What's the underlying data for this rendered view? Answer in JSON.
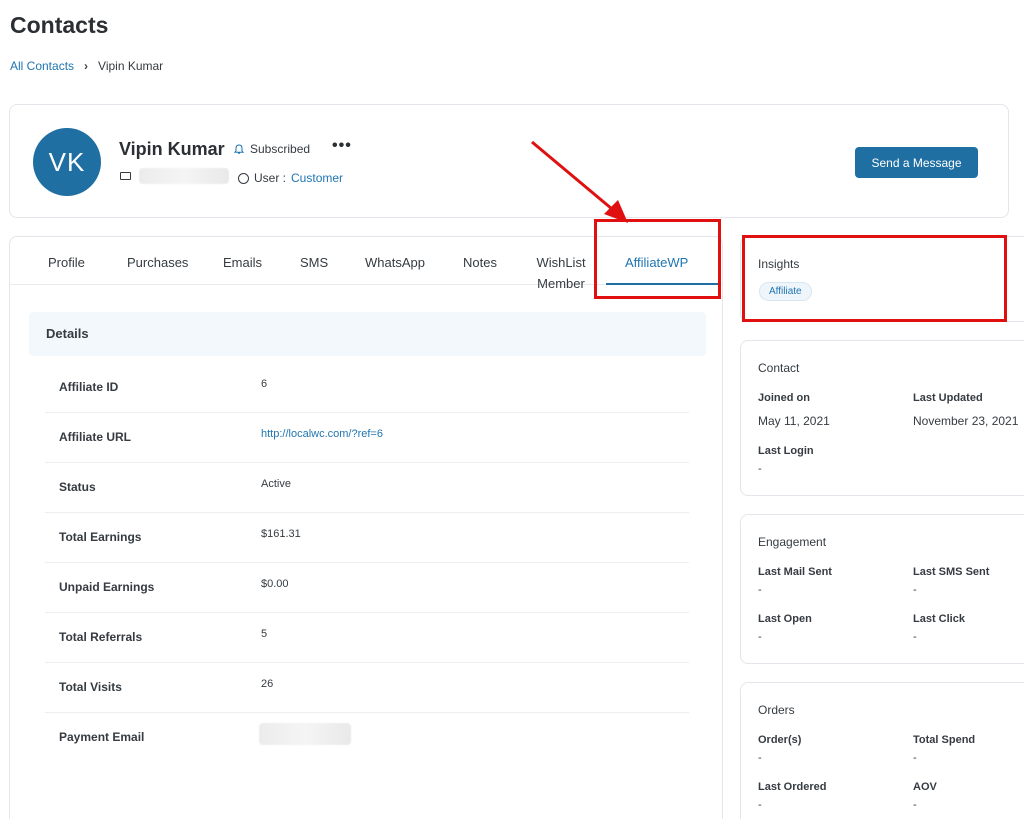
{
  "page": {
    "title": "Contacts"
  },
  "breadcrumb": {
    "parent": "All Contacts",
    "current": "Vipin Kumar"
  },
  "contact": {
    "initials": "VK",
    "name": "Vipin Kumar",
    "subscription_status": "Subscribed",
    "more": "•••",
    "user_prefix": "User :",
    "user_role": "Customer",
    "send_button": "Send a Message"
  },
  "tabs": [
    {
      "label": "Profile"
    },
    {
      "label": "Purchases"
    },
    {
      "label": "Emails"
    },
    {
      "label": "SMS"
    },
    {
      "label": "WhatsApp"
    },
    {
      "label": "Notes"
    },
    {
      "label": "WishList Member"
    },
    {
      "label": "AffiliateWP",
      "active": true
    }
  ],
  "details": {
    "title": "Details",
    "rows": [
      {
        "label": "Affiliate ID",
        "value": "6"
      },
      {
        "label": "Affiliate URL",
        "value": "http://localwc.com/?ref=6"
      },
      {
        "label": "Status",
        "value": "Active"
      },
      {
        "label": "Total Earnings",
        "value": "$161.31"
      },
      {
        "label": "Unpaid Earnings",
        "value": "$0.00"
      },
      {
        "label": "Total Referrals",
        "value": "5"
      },
      {
        "label": "Total Visits",
        "value": "26"
      },
      {
        "label": "Payment Email",
        "value": ""
      }
    ]
  },
  "insights": {
    "title": "Insights",
    "badge": "Affiliate"
  },
  "contact_info": {
    "title": "Contact",
    "joined_label": "Joined on",
    "joined_value": "May 11, 2021",
    "updated_label": "Last Updated",
    "updated_value": "November 23, 2021",
    "login_label": "Last Login",
    "login_value": "-"
  },
  "engagement": {
    "title": "Engagement",
    "mail_label": "Last Mail Sent",
    "mail_value": "-",
    "sms_label": "Last SMS Sent",
    "sms_value": "-",
    "open_label": "Last Open",
    "open_value": "-",
    "click_label": "Last Click",
    "click_value": "-"
  },
  "orders": {
    "title": "Orders",
    "orders_label": "Order(s)",
    "orders_value": "-",
    "spend_label": "Total Spend",
    "spend_value": "-",
    "ordered_label": "Last Ordered",
    "ordered_value": "-",
    "aov_label": "AOV",
    "aov_value": "-"
  },
  "colors": {
    "accent": "#1f6fa3",
    "link": "#1f75b1",
    "annotation": "#e11010"
  },
  "icons": {
    "subscribed": "bell-icon",
    "email": "mail-icon",
    "user": "user-circle-icon",
    "breadcrumb_sep": "chevron-right-icon"
  }
}
